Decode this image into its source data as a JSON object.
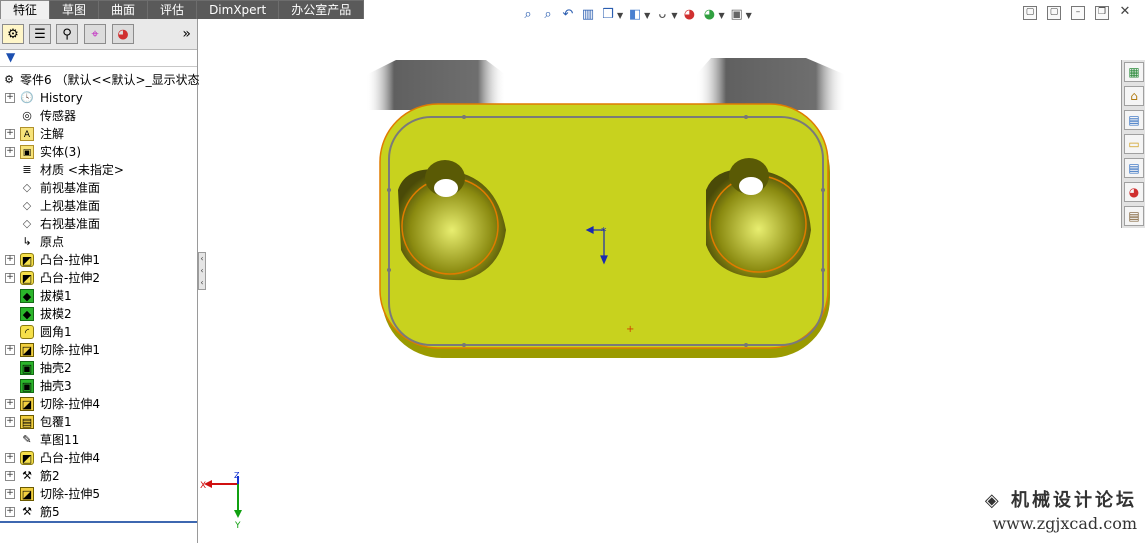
{
  "tabs": [
    {
      "label": "特征",
      "active": true
    },
    {
      "label": "草图",
      "active": false
    },
    {
      "label": "曲面",
      "active": false
    },
    {
      "label": "评估",
      "active": false
    },
    {
      "label": "DimXpert",
      "active": false
    },
    {
      "label": "办公室产品",
      "active": false
    }
  ],
  "panel": {
    "tab_icons": [
      "feature-manager-icon",
      "property-manager-icon",
      "configuration-manager-icon",
      "dimxpert-manager-icon",
      "display-manager-icon"
    ],
    "expand_glyph": "»",
    "filter_glyph": "▼"
  },
  "tree": {
    "root": "零件6 （默认<<默认>_显示状态",
    "items": [
      {
        "label": "History",
        "icon": "history-icon",
        "expandable": true
      },
      {
        "label": "传感器",
        "icon": "sensor-icon",
        "expandable": false
      },
      {
        "label": "注解",
        "icon": "annotation-icon",
        "expandable": true
      },
      {
        "label": "实体(3)",
        "icon": "solid-bodies-icon",
        "expandable": true
      },
      {
        "label": "材质 <未指定>",
        "icon": "material-icon",
        "expandable": false
      },
      {
        "label": "前视基准面",
        "icon": "plane-icon",
        "expandable": false
      },
      {
        "label": "上视基准面",
        "icon": "plane-icon",
        "expandable": false
      },
      {
        "label": "右视基准面",
        "icon": "plane-icon",
        "expandable": false
      },
      {
        "label": "原点",
        "icon": "origin-icon",
        "expandable": false
      },
      {
        "label": "凸台-拉伸1",
        "icon": "boss-extrude-icon",
        "expandable": true
      },
      {
        "label": "凸台-拉伸2",
        "icon": "boss-extrude-icon",
        "expandable": true
      },
      {
        "label": "拔模1",
        "icon": "draft-icon",
        "expandable": false
      },
      {
        "label": "拔模2",
        "icon": "draft-icon",
        "expandable": false
      },
      {
        "label": "圆角1",
        "icon": "fillet-icon",
        "expandable": false
      },
      {
        "label": "切除-拉伸1",
        "icon": "cut-extrude-icon",
        "expandable": true
      },
      {
        "label": "抽壳2",
        "icon": "shell-icon",
        "expandable": false
      },
      {
        "label": "抽壳3",
        "icon": "shell-icon",
        "expandable": false
      },
      {
        "label": "切除-拉伸4",
        "icon": "cut-extrude-icon",
        "expandable": true
      },
      {
        "label": "包覆1",
        "icon": "wrap-icon",
        "expandable": true
      },
      {
        "label": "草图11",
        "icon": "sketch-icon",
        "expandable": false
      },
      {
        "label": "凸台-拉伸4",
        "icon": "boss-extrude-icon",
        "expandable": true
      },
      {
        "label": "筋2",
        "icon": "rib-icon",
        "expandable": true
      },
      {
        "label": "切除-拉伸5",
        "icon": "cut-extrude-icon",
        "expandable": true
      },
      {
        "label": "筋5",
        "icon": "rib-icon",
        "expandable": true
      }
    ]
  },
  "triad": {
    "x_label": "X",
    "y_label": "Y",
    "z_label": "Z"
  },
  "watermark": {
    "title": "机械设计论坛",
    "url": "www.zgjxcad.com"
  },
  "colors": {
    "part_face": "#c8d21e",
    "part_edge": "#e07b00",
    "tab_dark": "#5a5a5a",
    "panel_accent": "#3d67b0"
  }
}
